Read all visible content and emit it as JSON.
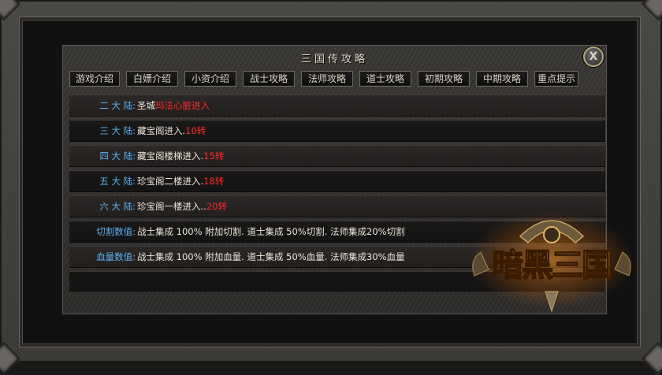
{
  "title": "三国传攻略",
  "close_label": "X",
  "tabs": [
    "游戏介绍",
    "白嫖介绍",
    "小资介绍",
    "战士攻略",
    "法师攻略",
    "道士攻略",
    "初期攻略",
    "中期攻略",
    "重点提示"
  ],
  "rows": [
    {
      "label": "二 大 陆:",
      "parts": [
        {
          "text": "圣城",
          "color": "white"
        },
        {
          "text": "玛法心脏进入",
          "color": "red"
        }
      ]
    },
    {
      "label": "三 大 陆:",
      "parts": [
        {
          "text": "藏宝阁进入.",
          "color": "white"
        },
        {
          "text": "10转",
          "color": "red"
        }
      ]
    },
    {
      "label": "四 大 陆:",
      "parts": [
        {
          "text": "藏宝阁楼梯进入.",
          "color": "white"
        },
        {
          "text": "15转",
          "color": "red"
        }
      ]
    },
    {
      "label": "五 大 陆:",
      "parts": [
        {
          "text": "珍宝阁二楼进入.",
          "color": "white"
        },
        {
          "text": "18转",
          "color": "red"
        }
      ]
    },
    {
      "label": "六 大 陆:",
      "parts": [
        {
          "text": "珍宝阁一楼进入..",
          "color": "white"
        },
        {
          "text": "20转",
          "color": "red"
        }
      ]
    },
    {
      "label": "切割数值:",
      "parts": [
        {
          "text": "战士集成 100% 附加切割. 道士集成 50%切割. 法师集成20%切割",
          "color": "white"
        }
      ]
    },
    {
      "label": "血量数值:",
      "parts": [
        {
          "text": "战士集成 100% 附加血量. 道士集成 50%血量. 法师集成30%血量",
          "color": "white"
        }
      ]
    }
  ],
  "logo_text": "暗黑三国",
  "colors": {
    "label_blue": "#5ab2f2",
    "highlight_red": "#ff2a2a",
    "text_white": "#ece6da",
    "logo_gold": "#f0b73a"
  }
}
